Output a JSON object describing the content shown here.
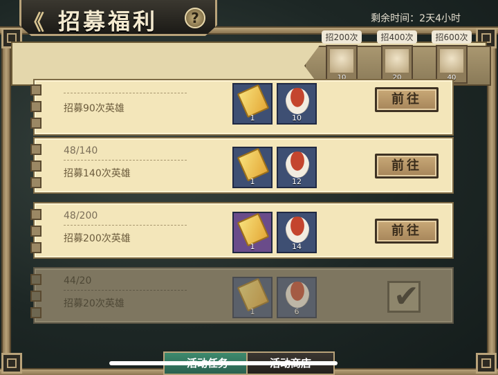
{
  "header": {
    "title": "招募福利",
    "help_symbol": "?",
    "back_symbol": "《",
    "timer": "剩余时间：2天4小时"
  },
  "milestones": [
    {
      "label": "招200次",
      "count": "10"
    },
    {
      "label": "招400次",
      "count": "20"
    },
    {
      "label": "招600次",
      "count": "40"
    }
  ],
  "tasks": [
    {
      "progress": "",
      "label": "招募90次英雄",
      "rewards": [
        {
          "icon": "ticket-icon",
          "count": "1",
          "purple": false
        },
        {
          "icon": "food-bowl-icon",
          "count": "10"
        }
      ],
      "action": "前往",
      "done": false
    },
    {
      "progress": "48/140",
      "label": "招募140次英雄",
      "rewards": [
        {
          "icon": "ticket-icon",
          "count": "1",
          "purple": false
        },
        {
          "icon": "food-bowl-icon",
          "count": "12"
        }
      ],
      "action": "前往",
      "done": false
    },
    {
      "progress": "48/200",
      "label": "招募200次英雄",
      "rewards": [
        {
          "icon": "ticket-icon",
          "count": "1",
          "purple": true
        },
        {
          "icon": "food-bowl-icon",
          "count": "14"
        }
      ],
      "action": "前往",
      "done": false
    },
    {
      "progress": "44/20",
      "label": "招募20次英雄",
      "rewards": [
        {
          "icon": "ticket-icon",
          "count": "1",
          "purple": false
        },
        {
          "icon": "food-bowl-icon",
          "count": "6"
        }
      ],
      "action": "",
      "done": true
    }
  ],
  "tabs": {
    "active": "活动任务",
    "inactive": "活动商店"
  },
  "colors": {
    "accent_gold": "#b9a37a",
    "active_tab": "#3d8a6e"
  }
}
